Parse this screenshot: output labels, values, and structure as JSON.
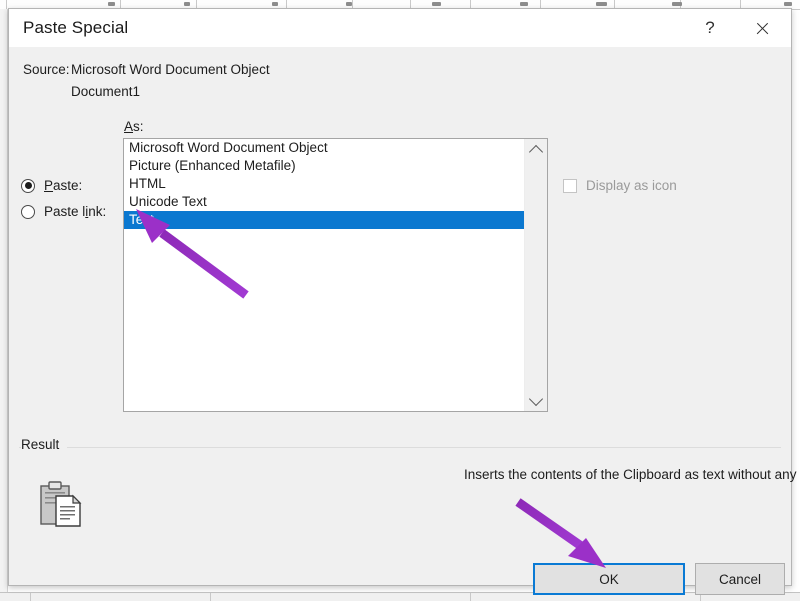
{
  "dialog": {
    "title": "Paste Special",
    "help_label": "?",
    "close_label": "close-icon",
    "source_label": "Source:",
    "source_value_line1": "Microsoft Word Document Object",
    "source_value_line2": "Document1",
    "as_label": "As:"
  },
  "paste_mode": {
    "paste_label": "Paste:",
    "paste_accel": "P",
    "paste_rest": "aste:",
    "paste_selected": true,
    "paste_link_label": "Paste link:",
    "paste_link_prefix": "Paste l",
    "paste_link_accel": "i",
    "paste_link_rest": "nk:",
    "paste_link_selected": false
  },
  "format_list": {
    "items": [
      "Microsoft Word Document Object",
      "Picture (Enhanced Metafile)",
      "HTML",
      "Unicode Text",
      "Text"
    ],
    "selected_index": 4,
    "selected_value": "Text",
    "scroll_up_icon": "chevron-up-icon",
    "scroll_down_icon": "chevron-down-icon"
  },
  "display_as_icon": {
    "label": "Display as icon",
    "checked": false,
    "enabled": false
  },
  "result": {
    "group_label": "Result",
    "description": "Inserts the contents of the Clipboard as text without any formatting.",
    "icon": "clipboard-paste-icon"
  },
  "buttons": {
    "ok_label": "OK",
    "cancel_label": "Cancel",
    "ok_focused": true
  },
  "annotations": {
    "arrow_to_text_item": "purple-arrow-icon",
    "arrow_to_ok_button": "purple-arrow-icon",
    "color": "#9b30c8"
  },
  "colors": {
    "selection_blue": "#0b78d0",
    "focus_blue": "#0a7ad4",
    "dialog_bg": "#f0f0f0",
    "titlebar_bg": "#ffffff",
    "annotation_purple": "#9b30c8"
  }
}
